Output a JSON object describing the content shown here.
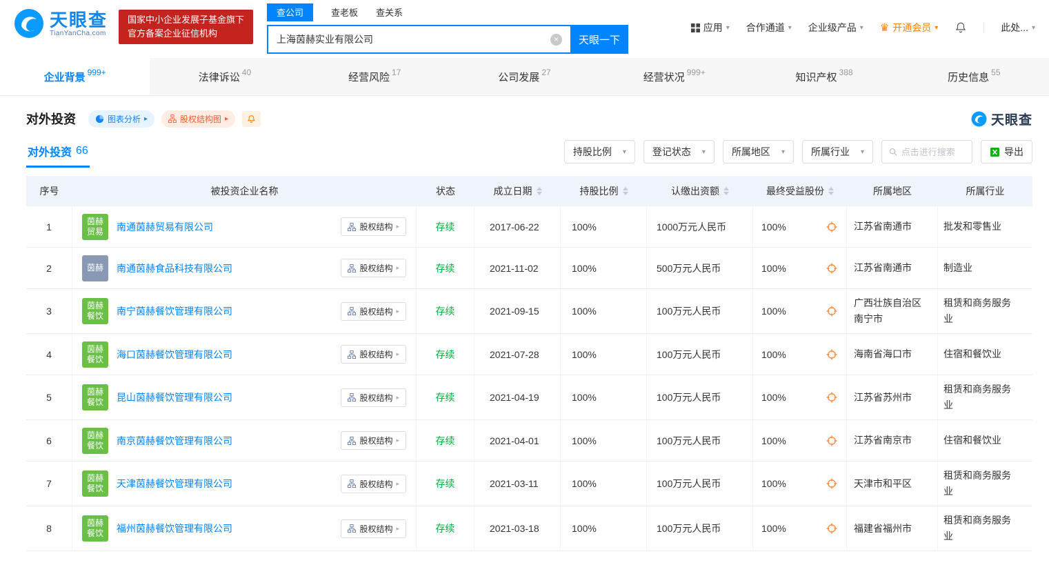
{
  "brand": {
    "logo_text": "天眼查",
    "logo_sub": "TianYanCha.com",
    "badge_line1": "国家中小企业发展子基金旗下",
    "badge_line2": "官方备案企业征信机构"
  },
  "search": {
    "tabs": [
      {
        "label": "查公司",
        "active": true
      },
      {
        "label": "查老板",
        "active": false
      },
      {
        "label": "查关系",
        "active": false
      }
    ],
    "value": "上海茵赫实业有限公司",
    "button_label": "天眼一下"
  },
  "top_nav": {
    "apps": "应用",
    "cooperation": "合作通道",
    "enterprise": "企业级产品",
    "vip": "开通会员",
    "user": "此处..."
  },
  "main_tabs": [
    {
      "label": "企业背景",
      "count": "999+",
      "active": true
    },
    {
      "label": "法律诉讼",
      "count": "40",
      "active": false
    },
    {
      "label": "经营风险",
      "count": "17",
      "active": false
    },
    {
      "label": "公司发展",
      "count": "27",
      "active": false
    },
    {
      "label": "经营状况",
      "count": "999+",
      "active": false
    },
    {
      "label": "知识产权",
      "count": "388",
      "active": false
    },
    {
      "label": "历史信息",
      "count": "55",
      "active": false
    }
  ],
  "section": {
    "title": "对外投资",
    "chart_pill": "图表分析",
    "equity_pill": "股权结构图",
    "watermark": "天眼查",
    "subtab_label": "对外投资",
    "subtab_count": "66",
    "filters": [
      {
        "label": "持股比例"
      },
      {
        "label": "登记状态"
      },
      {
        "label": "所属地区"
      },
      {
        "label": "所属行业"
      }
    ],
    "search_placeholder": "点击进行搜索",
    "export_label": "导出"
  },
  "table": {
    "headers": {
      "no": "序号",
      "name": "被投资企业名称",
      "status": "状态",
      "date": "成立日期",
      "ratio": "持股比例",
      "capital": "认缴出资额",
      "benefit": "最终受益股份",
      "region": "所属地区",
      "industry": "所属行业"
    },
    "equity_button": "股权结构",
    "rows": [
      {
        "no": "1",
        "logo_text": "茵赫贸易",
        "logo_color": "green",
        "name": "南通茵赫贸易有限公司",
        "status": "存续",
        "date": "2017-06-22",
        "ratio": "100%",
        "capital": "1000万元人民币",
        "benefit": "100%",
        "region": "江苏省南通市",
        "industry": "批发和零售业"
      },
      {
        "no": "2",
        "logo_text": "茵赫",
        "logo_color": "slate",
        "name": "南通茵赫食品科技有限公司",
        "status": "存续",
        "date": "2021-11-02",
        "ratio": "100%",
        "capital": "500万元人民币",
        "benefit": "100%",
        "region": "江苏省南通市",
        "industry": "制造业"
      },
      {
        "no": "3",
        "logo_text": "茵赫餐饮",
        "logo_color": "green",
        "name": "南宁茵赫餐饮管理有限公司",
        "status": "存续",
        "date": "2021-09-15",
        "ratio": "100%",
        "capital": "100万元人民币",
        "benefit": "100%",
        "region": "广西壮族自治区南宁市",
        "industry": "租赁和商务服务业"
      },
      {
        "no": "4",
        "logo_text": "茵赫餐饮",
        "logo_color": "green",
        "name": "海口茵赫餐饮管理有限公司",
        "status": "存续",
        "date": "2021-07-28",
        "ratio": "100%",
        "capital": "100万元人民币",
        "benefit": "100%",
        "region": "海南省海口市",
        "industry": "住宿和餐饮业"
      },
      {
        "no": "5",
        "logo_text": "茵赫餐饮",
        "logo_color": "green",
        "name": "昆山茵赫餐饮管理有限公司",
        "status": "存续",
        "date": "2021-04-19",
        "ratio": "100%",
        "capital": "100万元人民币",
        "benefit": "100%",
        "region": "江苏省苏州市",
        "industry": "租赁和商务服务业"
      },
      {
        "no": "6",
        "logo_text": "茵赫餐饮",
        "logo_color": "green",
        "name": "南京茵赫餐饮管理有限公司",
        "status": "存续",
        "date": "2021-04-01",
        "ratio": "100%",
        "capital": "100万元人民币",
        "benefit": "100%",
        "region": "江苏省南京市",
        "industry": "住宿和餐饮业"
      },
      {
        "no": "7",
        "logo_text": "茵赫餐饮",
        "logo_color": "green",
        "name": "天津茵赫餐饮管理有限公司",
        "status": "存续",
        "date": "2021-03-11",
        "ratio": "100%",
        "capital": "100万元人民币",
        "benefit": "100%",
        "region": "天津市和平区",
        "industry": "租赁和商务服务业"
      },
      {
        "no": "8",
        "logo_text": "茵赫餐饮",
        "logo_color": "green",
        "name": "福州茵赫餐饮管理有限公司",
        "status": "存续",
        "date": "2021-03-18",
        "ratio": "100%",
        "capital": "100万元人民币",
        "benefit": "100%",
        "region": "福建省福州市",
        "industry": "租赁和商务服务业"
      }
    ]
  },
  "colors": {
    "primary": "#0084ff",
    "status_green": "#00b038",
    "logo_green": "#6abf47",
    "logo_slate": "#8a99b3",
    "vip_orange": "#ff8000",
    "badge_red": "#c5231d"
  }
}
